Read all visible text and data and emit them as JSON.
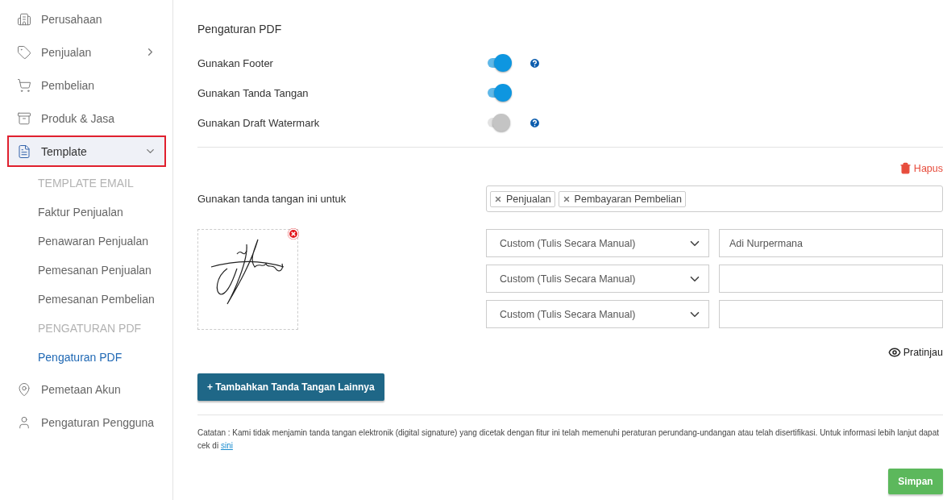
{
  "sidebar": {
    "items": [
      {
        "kind": "item",
        "label": "Perusahaan",
        "selected": false
      },
      {
        "kind": "item",
        "label": "Penjualan",
        "expanded": false,
        "selected": false
      },
      {
        "kind": "item",
        "label": "Pembelian",
        "selected": false
      },
      {
        "kind": "item",
        "label": "Produk & Jasa",
        "selected": false
      },
      {
        "kind": "item",
        "label": "Template",
        "expanded": true,
        "selected": true
      },
      {
        "kind": "heading",
        "label": "TEMPLATE EMAIL"
      },
      {
        "kind": "link",
        "label": "Faktur Penjualan",
        "selected": false
      },
      {
        "kind": "link",
        "label": "Penawaran Penjualan",
        "selected": false
      },
      {
        "kind": "link",
        "label": "Pemesanan Penjualan",
        "selected": false
      },
      {
        "kind": "link",
        "label": "Pemesanan Pembelian",
        "selected": false
      },
      {
        "kind": "heading",
        "label": "PENGATURAN PDF"
      },
      {
        "kind": "link",
        "label": "Pengaturan PDF",
        "selected": true
      },
      {
        "kind": "item",
        "label": "Pemetaan Akun",
        "selected": false
      },
      {
        "kind": "item",
        "label": "Pengaturan Pengguna",
        "selected": false
      }
    ]
  },
  "title": "Pengaturan PDF",
  "toggles": [
    {
      "label": "Gunakan Footer",
      "on": true,
      "help": true
    },
    {
      "label": "Gunakan Tanda Tangan",
      "on": true,
      "help": false
    },
    {
      "label": "Gunakan Draft Watermark",
      "on": false,
      "help": true
    }
  ],
  "delete_button": "Hapus",
  "usage": {
    "label": "Gunakan tanda tangan ini untuk",
    "tags": [
      "Penjualan",
      "Pembayaran Pembelian"
    ]
  },
  "signers": [
    {
      "select": "Custom (Tulis Secara Manual)",
      "name": "Adi Nurpermana"
    },
    {
      "select": "Custom (Tulis Secara Manual)"
    },
    {
      "select": "Custom (Tulis Secara Manual)"
    }
  ],
  "preview_button": "Pratinjau",
  "add_button": "+ Tambahkan Tanda Tangan Lainnya",
  "note": {
    "text": "Catatan : Kami tidak menjamin tanda tangan elektronik (digital signature) yang dicetak dengan fitur ini telah memenuhi peraturan perundang-undangan atau telah disertifikasi. Untuk informasi lebih lanjut dapat cek di",
    "link": "sini"
  },
  "save_button": "Simpan"
}
